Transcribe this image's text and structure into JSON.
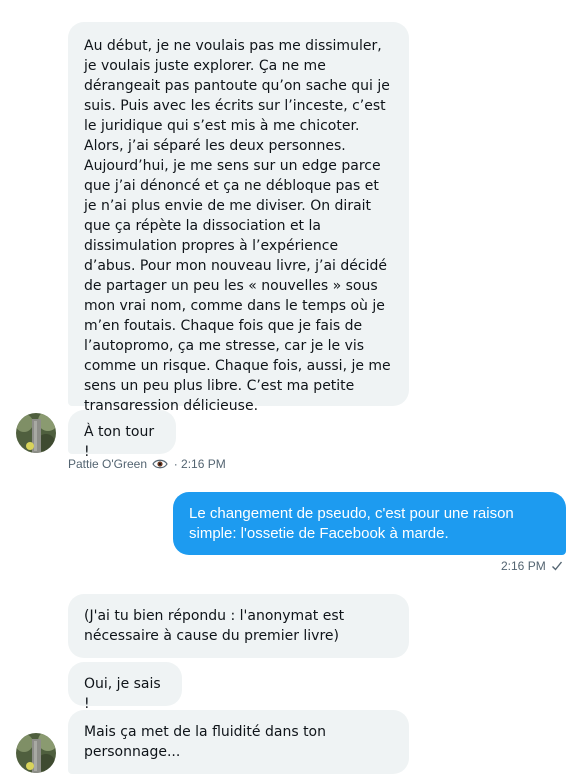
{
  "messages": {
    "m1": "Au début, je ne voulais pas me dissimuler, je voulais juste explorer. Ça ne me dérangeait pas pantoute qu’on sache qui je suis. Puis avec les écrits sur l’inceste, c’est le juridique qui s’est mis à me chicoter. Alors, j’ai séparé les deux personnes.  Aujourd’hui, je me sens sur un edge parce que j’ai dénoncé et ça ne débloque pas et je n’ai plus envie de me diviser. On dirait que ça répète la dissociation et la dissimulation propres à l’expérience d’abus. Pour mon nouveau livre, j’ai décidé de partager un peu les « nouvelles » sous mon vrai nom, comme dans le temps où je m’en foutais. Chaque fois que je fais de l’autopromo, ça me stresse, car je le vis comme un risque. Chaque fois, aussi, je me sens un peu plus libre. C’est ma petite transgression délicieuse.",
    "m2": "À ton tour !",
    "m3": "Le changement de pseudo, c'est pour une raison simple: l'ossetie de Facebook à marde.",
    "m4": "(J'ai tu bien répondu : l'anonymat est nécessaire à cause du premier livre)",
    "m5": "Oui, je sais !",
    "m6": "Mais ça met de la fluidité dans ton personnage..."
  },
  "meta1": {
    "sender": "Pattie O'Green",
    "separator": "·",
    "time": "2:16 PM"
  },
  "meta2": {
    "time": "2:16 PM"
  },
  "icons": {
    "eye": "eye-icon",
    "check": "check-icon",
    "avatar": "avatar"
  },
  "colors": {
    "incoming": "#eff3f4",
    "outgoing": "#1d9bf0",
    "meta": "#536471"
  }
}
